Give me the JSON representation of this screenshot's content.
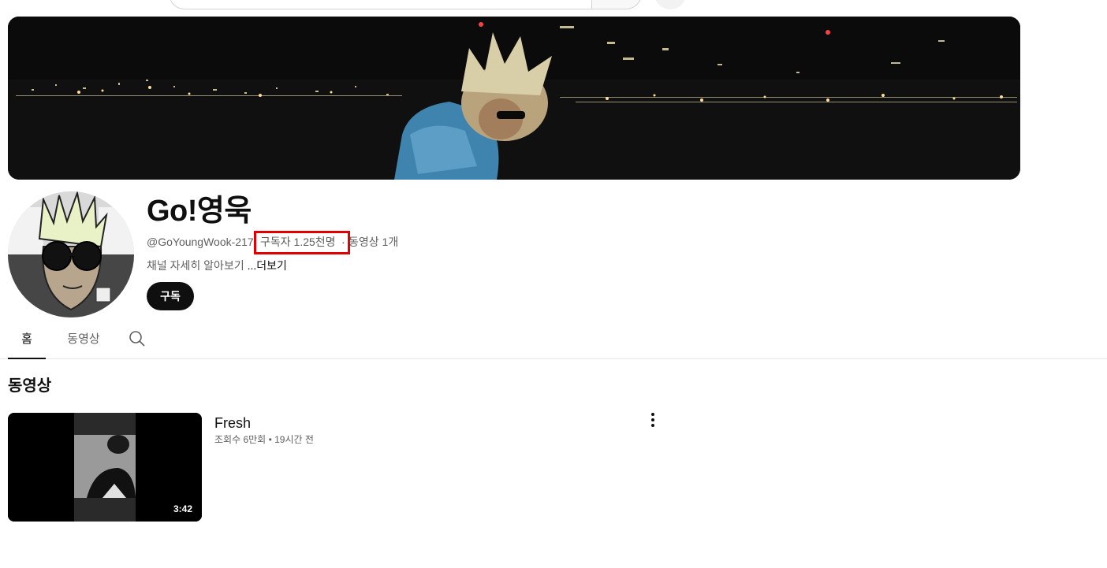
{
  "channel": {
    "name": "Go!영욱",
    "handle": "@GoYoungWook-217",
    "subscribers": "구독자 1.25천명",
    "separator": "·",
    "video_count": "동영상 1개",
    "description": "채널 자세히 알아보기 ",
    "more_label": "...더보기",
    "subscribe_label": "구독"
  },
  "tabs": [
    {
      "label": "홈",
      "active": true
    },
    {
      "label": "동영상",
      "active": false
    }
  ],
  "section": {
    "title": "동영상"
  },
  "video": {
    "title": "Fresh",
    "views": "조회수 6만회",
    "dot": "•",
    "age": "19시간 전",
    "duration": "3:42"
  },
  "icons": {
    "search": "search-icon",
    "more": "more-vert-icon"
  },
  "colors": {
    "highlight": "#e00000",
    "button_bg": "#0f0f0f",
    "secondary_text": "#606060"
  }
}
